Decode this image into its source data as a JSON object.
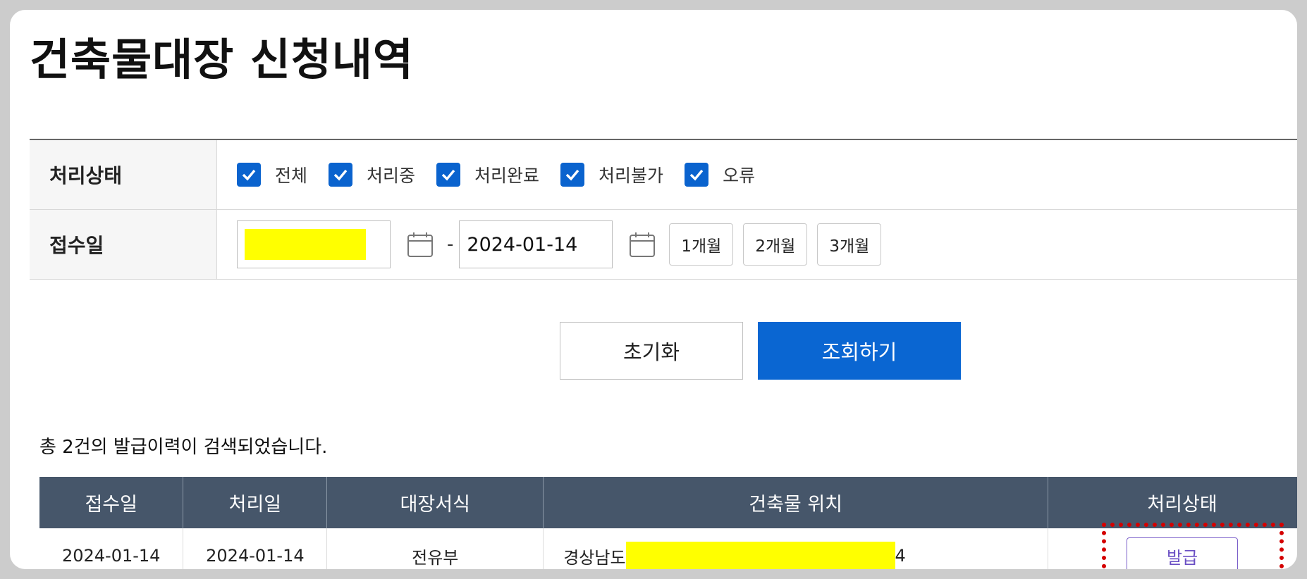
{
  "page": {
    "title": "건축물대장 신청내역"
  },
  "filter": {
    "status_label": "처리상태",
    "status_options": [
      {
        "label": "전체",
        "checked": true
      },
      {
        "label": "처리중",
        "checked": true
      },
      {
        "label": "처리완료",
        "checked": true
      },
      {
        "label": "처리불가",
        "checked": true
      },
      {
        "label": "오류",
        "checked": true
      }
    ],
    "date_label": "접수일",
    "date_from": "",
    "date_separator": "-",
    "date_to": "2024-01-14",
    "periods": [
      "1개월",
      "2개월",
      "3개월"
    ]
  },
  "actions": {
    "reset": "초기화",
    "search": "조회하기"
  },
  "results": {
    "summary": "총 2건의 발급이력이 검색되었습니다.",
    "columns": [
      "접수일",
      "처리일",
      "대장서식",
      "건축물 위치",
      "처리상태"
    ],
    "rows": [
      {
        "received": "2024-01-14",
        "processed": "2024-01-14",
        "form": "전유부",
        "location_prefix": "경상남도",
        "location_suffix": "4",
        "status_button": "발급"
      }
    ]
  },
  "colors": {
    "primary": "#0a66d2",
    "header_bg": "#46566a",
    "highlight": "#d40000",
    "redaction": "#ffff00"
  }
}
